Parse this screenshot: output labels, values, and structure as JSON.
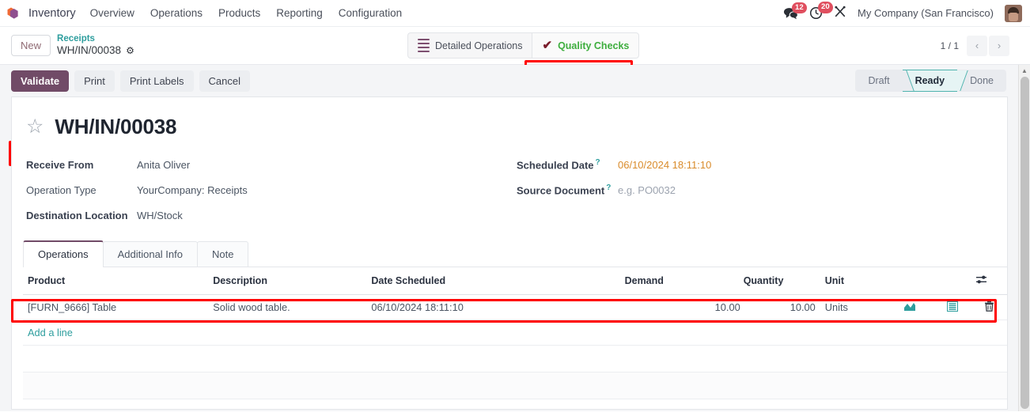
{
  "navbar": {
    "logo_icon": "odoo-cube-icon",
    "app_name": "Inventory",
    "menu": [
      {
        "label": "Overview"
      },
      {
        "label": "Operations"
      },
      {
        "label": "Products"
      },
      {
        "label": "Reporting"
      },
      {
        "label": "Configuration"
      }
    ],
    "messages_icon": "messages-icon",
    "messages_count": "12",
    "activities_icon": "activities-clock-icon",
    "activities_count": "20",
    "debug_icon": "developer-tools-icon",
    "company": "My Company (San Francisco)",
    "avatar_icon": "user-avatar"
  },
  "control_panel": {
    "new_label": "New",
    "breadcrumb_parent": "Receipts",
    "breadcrumb_current": "WH/IN/00038",
    "settings_icon": "gear-icon",
    "stat_buttons": [
      {
        "label": "Detailed Operations",
        "icon": "list-lines-icon"
      },
      {
        "label": "Quality Checks",
        "icon": "check-icon"
      }
    ],
    "pager": {
      "count": "1 / 1",
      "prev_icon": "chevron-left-icon",
      "next_icon": "chevron-right-icon"
    }
  },
  "actions": {
    "validate_label": "Validate",
    "print_label": "Print",
    "print_labels_label": "Print Labels",
    "cancel_label": "Cancel"
  },
  "statusbar": {
    "steps": [
      {
        "label": "Draft",
        "active": false
      },
      {
        "label": "Ready",
        "active": true
      },
      {
        "label": "Done",
        "active": false
      }
    ]
  },
  "record": {
    "favorite_icon": "star-icon",
    "title": "WH/IN/00038",
    "fields_left": [
      {
        "label": "Receive From",
        "value": "Anita Oliver",
        "bold": true
      },
      {
        "label": "Operation Type",
        "value": "YourCompany: Receipts",
        "bold": false
      },
      {
        "label": "Destination Location",
        "value": "WH/Stock",
        "bold": true
      }
    ],
    "fields_right": [
      {
        "label": "Scheduled Date",
        "value": "06/10/2024 18:11:10",
        "tip": "?",
        "kind": "date"
      },
      {
        "label": "Source Document",
        "value": "e.g. PO0032",
        "tip": "?",
        "kind": "placeholder"
      }
    ]
  },
  "notebook": {
    "tabs": [
      {
        "label": "Operations",
        "active": true
      },
      {
        "label": "Additional Info",
        "active": false
      },
      {
        "label": "Note",
        "active": false
      }
    ]
  },
  "table": {
    "headers": {
      "product": "Product",
      "description": "Description",
      "date_scheduled": "Date Scheduled",
      "demand": "Demand",
      "quantity": "Quantity",
      "unit": "Unit",
      "optional_columns_icon": "column-options-icon"
    },
    "rows": [
      {
        "product": "[FURN_9666] Table",
        "description": "Solid wood table.",
        "date_scheduled": "06/10/2024 18:11:10",
        "demand": "10.00",
        "quantity": "10.00",
        "unit": "Units",
        "forecast_icon": "forecast-chart-icon",
        "detailed_operations_icon": "detailed-operations-icon",
        "delete_icon": "trash-icon"
      }
    ],
    "add_line_label": "Add a line"
  },
  "colors": {
    "primary": "#714b67",
    "teal": "#2e9e9e",
    "green": "#3eae3e",
    "highlight": "#ff0000",
    "date_orange": "#d98b2b"
  }
}
